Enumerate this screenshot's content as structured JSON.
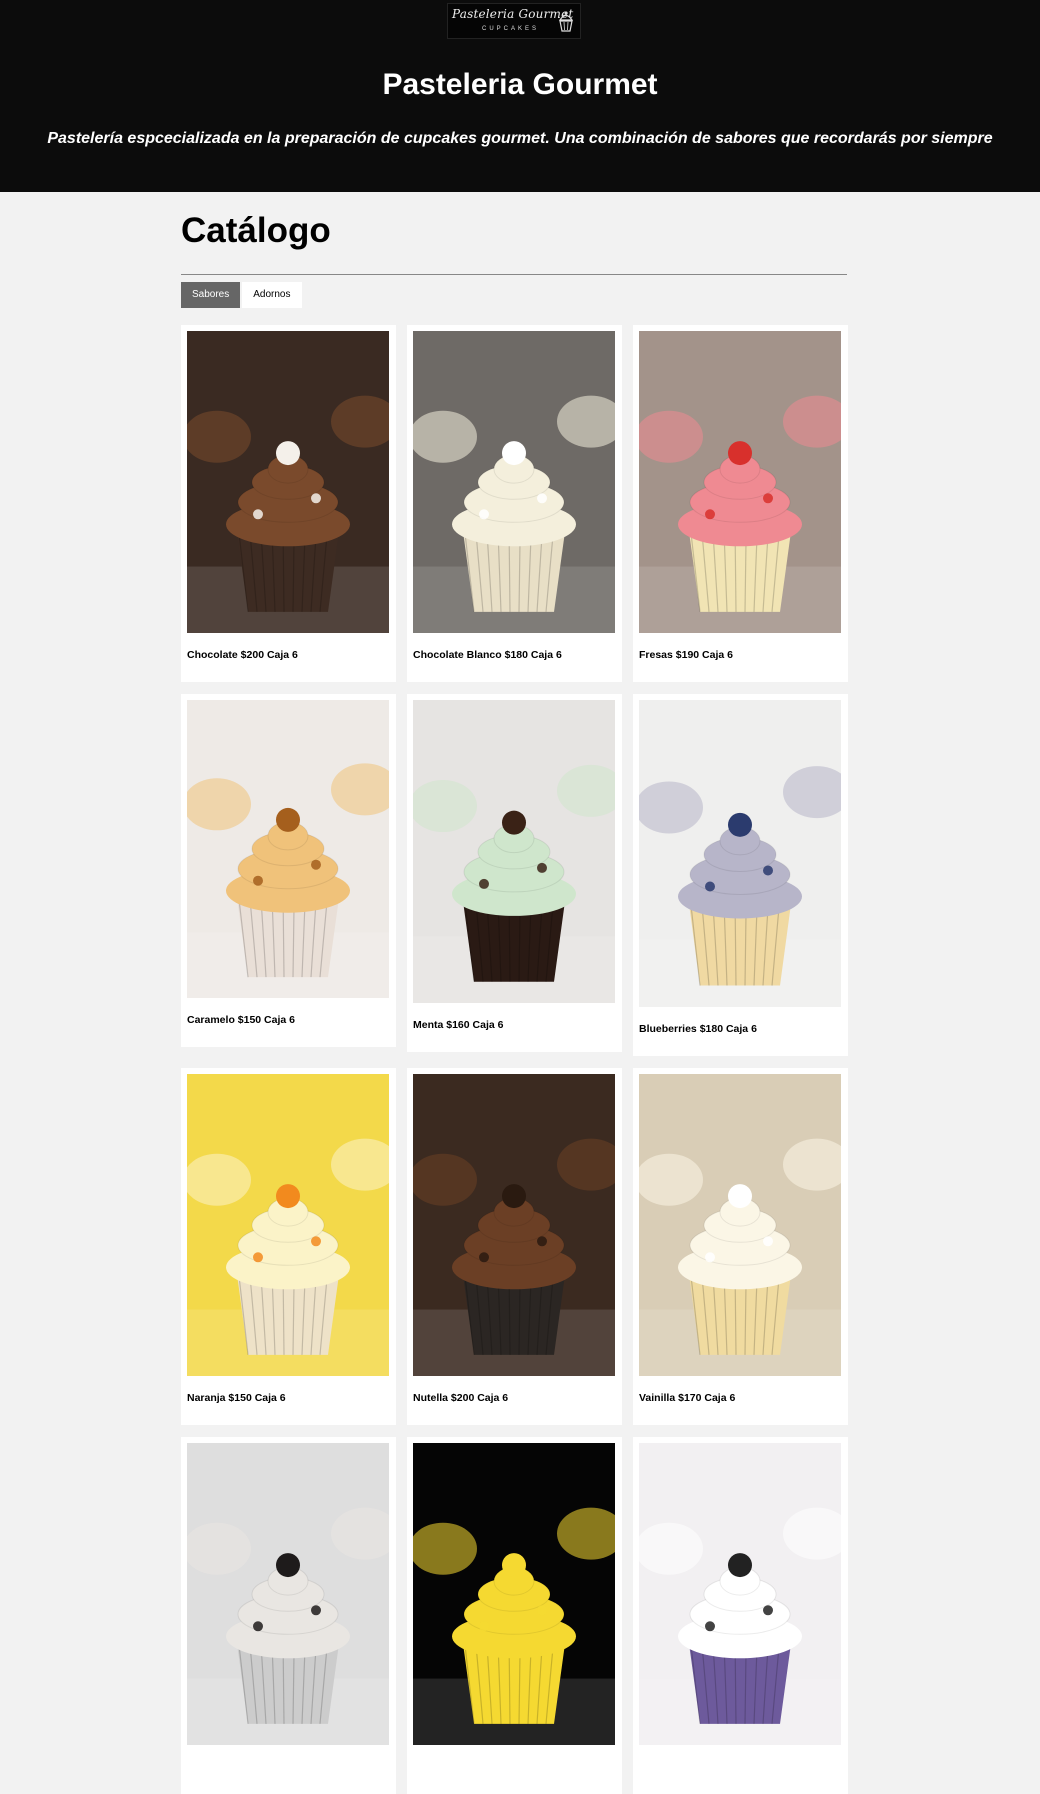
{
  "header": {
    "logo_script": "Pasteleria Gourmet",
    "logo_sub": "CUPCAKES",
    "title": "Pasteleria Gourmet",
    "tagline": "Pastelería espcecializada en la preparación de cupcakes gourmet. Una combinación de sabores que recordarás por siempre"
  },
  "catalog": {
    "title": "Catálogo",
    "tabs": [
      {
        "label": "Sabores",
        "active": true
      },
      {
        "label": "Adornos",
        "active": false
      }
    ]
  },
  "products": [
    {
      "label": "Chocolate $200 Caja 6",
      "image": "chocolate-marshmallow-cupcake",
      "bg": "#3a2a22",
      "frosting": "#7a4a2c",
      "liner": "#3d2b22",
      "topping": "#f4f0ea"
    },
    {
      "label": "Chocolate Blanco $180 Caja 6",
      "image": "white-chocolate-cupcake",
      "bg": "#6e6a66",
      "frosting": "#f4efdc",
      "liner": "#e8dfc6",
      "topping": "#ffffff"
    },
    {
      "label": "Fresas $190 Caja 6",
      "image": "strawberry-cupcake",
      "bg": "#a3938a",
      "frosting": "#ef8a92",
      "liner": "#f1e4b4",
      "topping": "#d8302c"
    },
    {
      "label": "Caramelo $150 Caja 6",
      "image": "caramel-cupcake",
      "bg": "#eeeae6",
      "frosting": "#f0c27a",
      "liner": "#e9dfd7",
      "topping": "#a55f1d"
    },
    {
      "label": "Menta $160 Caja 6",
      "image": "mint-chocolate-cupcake",
      "bg": "#e6e4e2",
      "frosting": "#cfe6cc",
      "liner": "#2a1a14",
      "topping": "#3a2216"
    },
    {
      "label": "Blueberries $180 Caja 6",
      "image": "blueberry-cupcake",
      "bg": "#efefee",
      "frosting": "#b7b5c9",
      "liner": "#f0d9a2",
      "topping": "#2b3b6e"
    },
    {
      "label": "Naranja $150 Caja 6",
      "image": "orange-cupcake",
      "bg": "#f3d94a",
      "frosting": "#fbf3c8",
      "liner": "#eee2c8",
      "topping": "#f28a1e"
    },
    {
      "label": "Nutella $200 Caja 6",
      "image": "nutella-cupcake",
      "bg": "#3b2a20",
      "frosting": "#6b3f25",
      "liner": "#2b2623",
      "topping": "#2a1a10"
    },
    {
      "label": "Vainilla $170 Caja 6",
      "image": "vanilla-cupcake",
      "bg": "#d9cdb6",
      "frosting": "#fbf6e6",
      "liner": "#f0dba0",
      "topping": "#ffffff"
    },
    {
      "label": "",
      "image": "oreo-cupcake",
      "bg": "#dedede",
      "frosting": "#e9e6e2",
      "liner": "#cccccc",
      "topping": "#1e1b1b"
    },
    {
      "label": "",
      "image": "pikachu-cupcake",
      "bg": "#050505",
      "frosting": "#f5d931",
      "liner": "#f5d931",
      "topping": "#f5d931"
    },
    {
      "label": "",
      "image": "ghost-cupcake",
      "bg": "#f2f0f2",
      "frosting": "#ffffff",
      "liner": "#6d5a9c",
      "topping": "#222222"
    }
  ]
}
